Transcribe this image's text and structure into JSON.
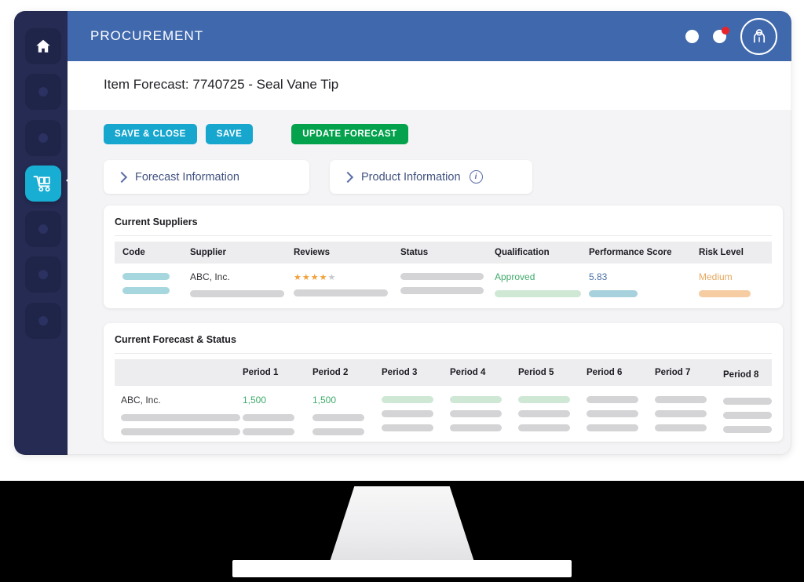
{
  "app": {
    "topbar_title": "PROCUREMENT",
    "icons": {
      "home": "home-icon",
      "cart": "shopping-cart-icon",
      "notification_dot": "dot-icon",
      "alert_dot": "dot-badge-icon",
      "avatar": "user-avatar-icon"
    }
  },
  "page": {
    "title": "Item Forecast: 7740725 - Seal Vane Tip"
  },
  "toolbar": {
    "save_close_label": "SAVE & CLOSE",
    "save_label": "SAVE",
    "update_forecast_label": "UPDATE FORECAST"
  },
  "panels": [
    {
      "label": "Forecast Information",
      "has_info": false
    },
    {
      "label": "Product Information",
      "has_info": true,
      "info_glyph": "i"
    }
  ],
  "suppliers_card": {
    "title": "Current Suppliers",
    "columns": [
      "Code",
      "Supplier",
      "Reviews",
      "Status",
      "Qualification",
      "Performance Score",
      "Risk Level"
    ],
    "row": {
      "code": "",
      "supplier": "ABC, Inc.",
      "reviews_filled": 4,
      "reviews_total": 5,
      "status": "",
      "qualification": "Approved",
      "performance_score": "5.83",
      "risk_level": "Medium"
    }
  },
  "forecast_card": {
    "title": "Current Forecast & Status",
    "columns": [
      "",
      "Period 1",
      "Period 2",
      "Period 3",
      "Period 4",
      "Period 5",
      "Period 6",
      "Period 7",
      "Period 8"
    ],
    "row": {
      "name": "ABC, Inc.",
      "values": [
        "1,500",
        "1,500",
        "",
        "",
        "",
        "",
        "",
        ""
      ]
    }
  },
  "colors": {
    "topbar_blue": "#4069ad",
    "sidebar_navy": "#252b52",
    "accent_cyan": "#17a6cd",
    "accent_green": "#04a24d",
    "active_nav": "#18aed4",
    "status_green": "#3faa6b",
    "status_orange": "#e6a75f",
    "badge_red": "#e8242a"
  }
}
